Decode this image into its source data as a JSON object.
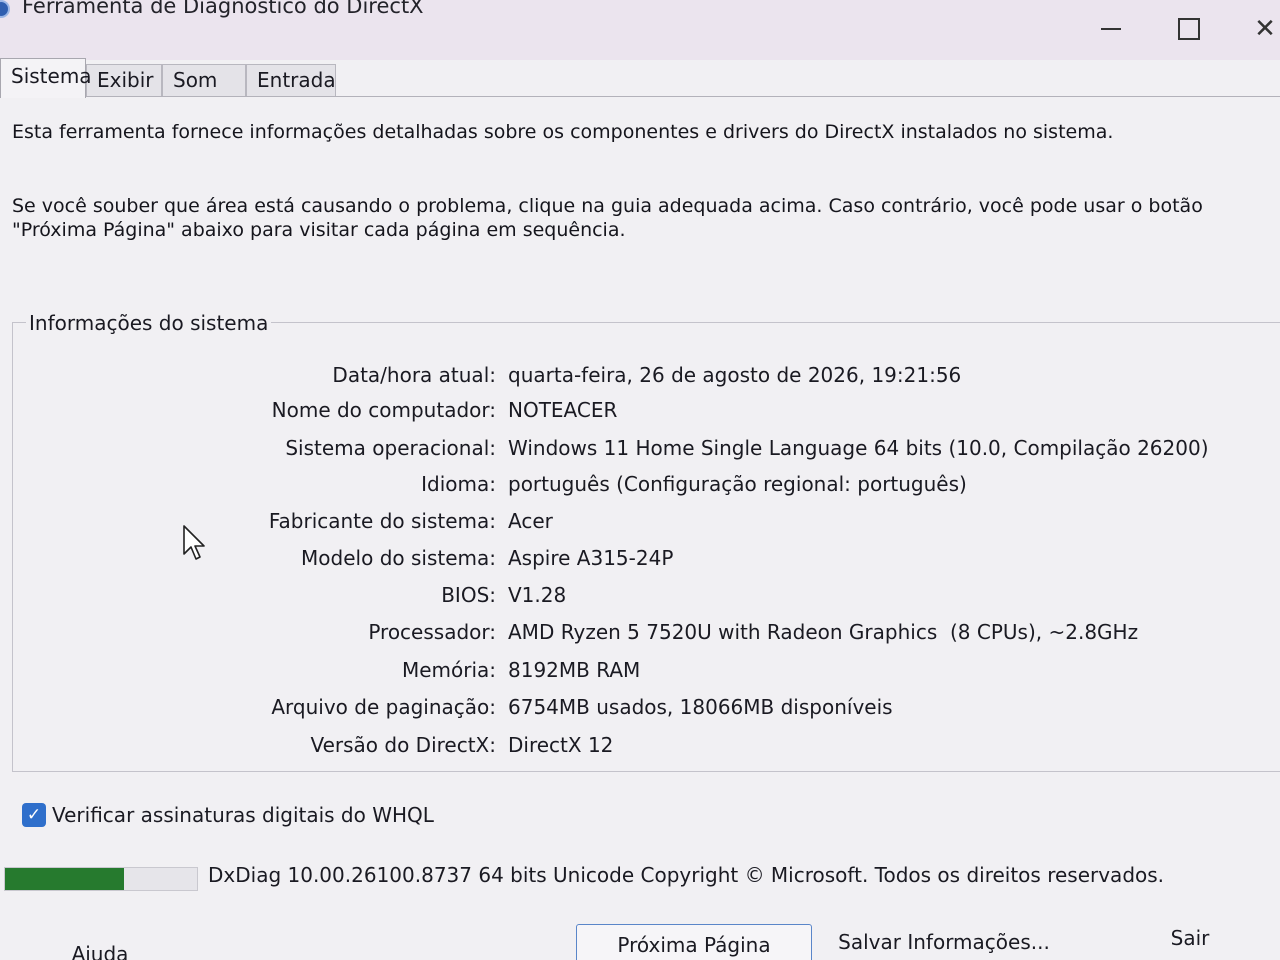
{
  "window": {
    "title": "Ferramenta de Diagnóstico do DirectX",
    "close_glyph": "✕"
  },
  "tabs": [
    {
      "label": "Sistema"
    },
    {
      "label": "Exibir"
    },
    {
      "label": "Som"
    },
    {
      "label": "Entrada"
    }
  ],
  "intro": {
    "line1": "Esta ferramenta fornece informações detalhadas sobre os componentes e drivers do DirectX instalados no sistema.",
    "line2": "Se você souber que área está causando o problema, clique na guia adequada acima. Caso contrário, você pode usar o botão \"Próxima Página\" abaixo para visitar cada página em sequência."
  },
  "system_info": {
    "group_title": "Informações do sistema",
    "rows": [
      {
        "label": "Data/hora atual:",
        "value": "quarta-feira, 26 de agosto de 2026, 19:21:56"
      },
      {
        "label": "Nome do computador:",
        "value": "NOTEACER"
      },
      {
        "label": "Sistema operacional:",
        "value": "Windows 11 Home Single Language 64 bits (10.0, Compilação 26200)"
      },
      {
        "label": "Idioma:",
        "value": "português (Configuração regional: português)"
      },
      {
        "label": "Fabricante do sistema:",
        "value": "Acer"
      },
      {
        "label": "Modelo do sistema:",
        "value": "Aspire A315-24P"
      },
      {
        "label": "BIOS:",
        "value": "V1.28"
      },
      {
        "label": "Processador:",
        "value": "AMD Ryzen 5 7520U with Radeon Graphics",
        "extra": "(8 CPUs), ~2.8GHz"
      },
      {
        "label": "Memória:",
        "value": "8192MB RAM"
      },
      {
        "label": "Arquivo de paginação:",
        "value": "6754MB usados, 18066MB disponíveis"
      },
      {
        "label": "Versão do DirectX:",
        "value": "DirectX 12"
      }
    ]
  },
  "whql": {
    "label": "Verificar assinaturas digitais do WHQL",
    "checked": true,
    "check_glyph": "✓"
  },
  "progress": {
    "fraction": 0.62,
    "color": "#267a2e"
  },
  "status": {
    "text": "DxDiag 10.00.26100.8737 64 bits Unicode  Copyright © Microsoft. Todos os direitos reservados."
  },
  "buttons": {
    "help": "Ajuda",
    "next": "Próxima Página",
    "save": "Salvar Informações...",
    "exit": "Sair"
  },
  "colors": {
    "accent": "#2f6fcb",
    "progress": "#267a2e"
  }
}
